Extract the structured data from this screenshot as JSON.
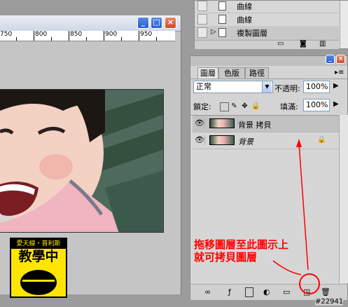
{
  "document": {
    "ruler_labels": [
      "750",
      "800",
      "850",
      "900",
      "950"
    ],
    "buttons": {
      "minimize": "_",
      "maximize": "□",
      "close": "×"
    }
  },
  "logo": {
    "top_text": "愛天線・普利斯",
    "main_text": "教學中"
  },
  "history": {
    "items": [
      {
        "label": "曲線",
        "selected": false
      },
      {
        "label": "曲線",
        "selected": false
      },
      {
        "label": "複製圖層",
        "selected": true
      }
    ]
  },
  "layers_panel": {
    "tabs": [
      "圖層",
      "色版",
      "路徑"
    ],
    "active_tab": "圖層",
    "blend_mode": "正常",
    "opacity_label": "不透明:",
    "opacity_value": "100%",
    "lock_label": "鎖定:",
    "fill_label": "填滿:",
    "fill_value": "100%",
    "layers": [
      {
        "name": "背景 拷貝",
        "selected": true,
        "locked": false
      },
      {
        "name": "背景",
        "selected": false,
        "locked": true
      }
    ]
  },
  "annotation": {
    "line1": "拖移圖層至此圖示上",
    "line2": "就可拷貝圖層"
  },
  "watermark": "#22941",
  "colors": {
    "annotation": "#ff0000",
    "logo_bg": "#ffe600"
  }
}
